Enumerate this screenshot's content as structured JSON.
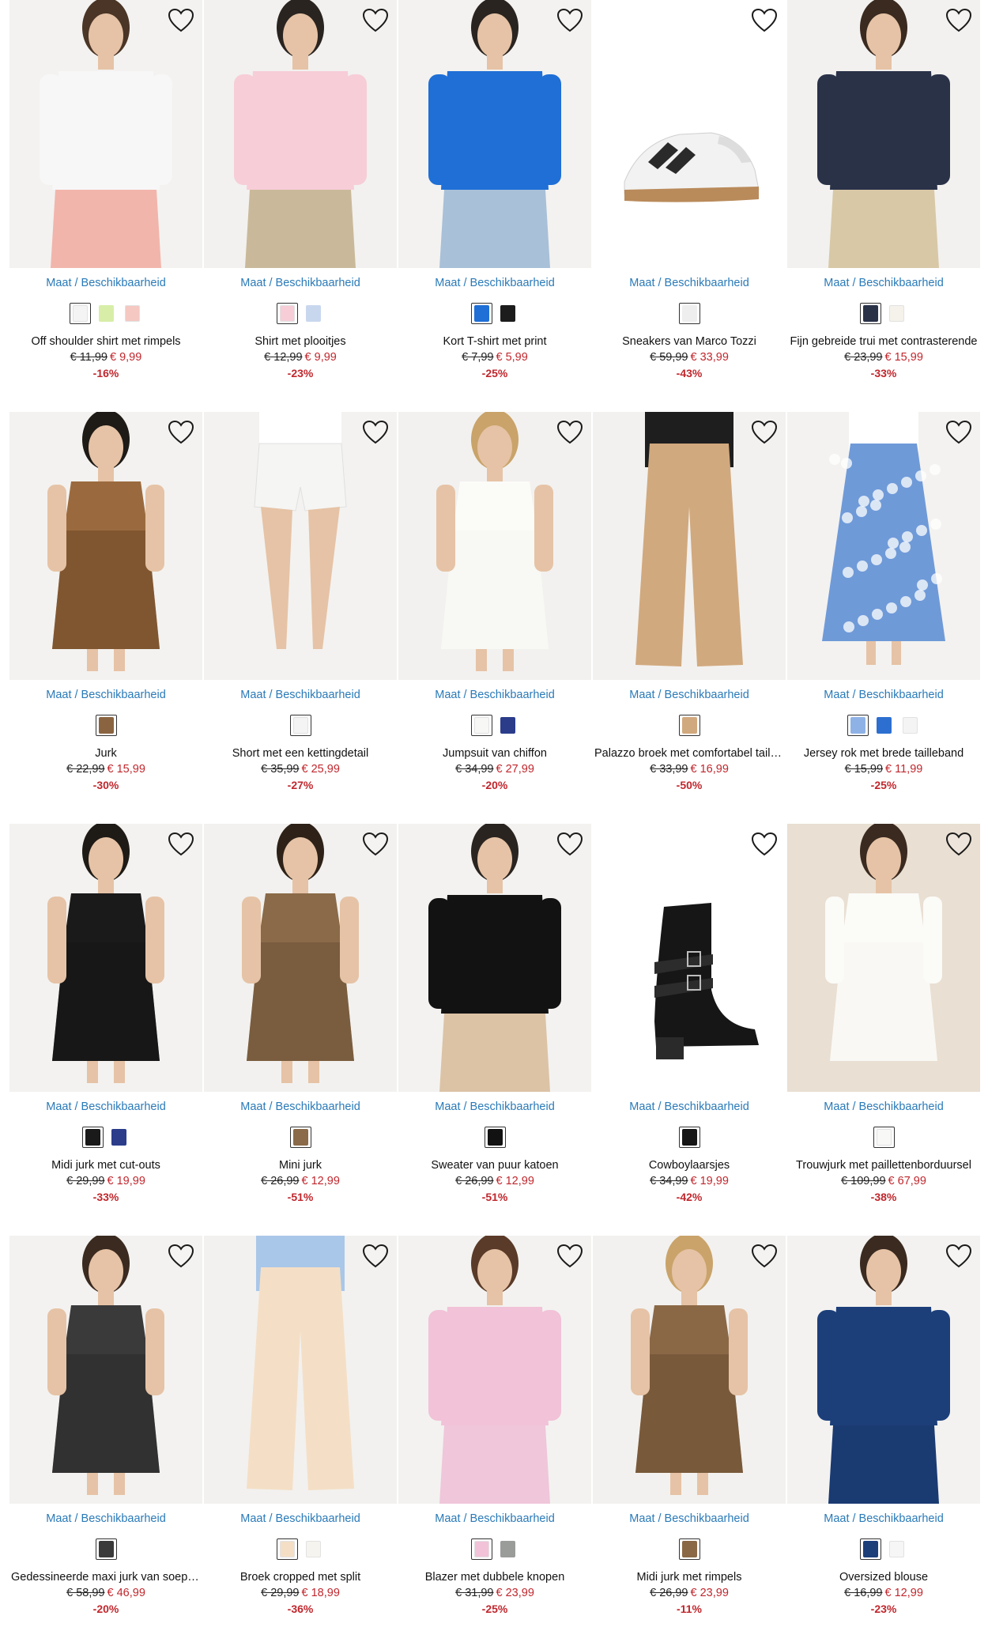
{
  "products": [
    {
      "name": "Off shoulder shirt met rimpels",
      "size_link": "Maat / Beschikbaarheid",
      "old_price": "€ 11,99",
      "new_price": "€ 9,99",
      "discount": "-16%",
      "image": {
        "kind": "model",
        "bg": "#f3f2f0",
        "top": "#f7f7f7",
        "bottom": "#f2b5ab",
        "hair": "#4a3526"
      },
      "swatches": [
        "#f4f4f4",
        "#d8eea8",
        "#f5c8c2"
      ]
    },
    {
      "name": "Shirt met plooitjes",
      "size_link": "Maat / Beschikbaarheid",
      "old_price": "€ 12,99",
      "new_price": "€ 9,99",
      "discount": "-23%",
      "image": {
        "kind": "model",
        "bg": "#f2f1ef",
        "top": "#f7cdd8",
        "bottom": "#c9b99a",
        "hair": "#2a2420"
      },
      "swatches": [
        "#f7cdd8",
        "#c9d7ee"
      ]
    },
    {
      "name": "Kort T-shirt met print",
      "size_link": "Maat / Beschikbaarheid",
      "old_price": "€ 7,99",
      "new_price": "€ 5,99",
      "discount": "-25%",
      "image": {
        "kind": "model",
        "bg": "#f3f2f0",
        "top": "#1f6fd6",
        "bottom": "#a8c0d8",
        "hair": "#2a2420"
      },
      "swatches": [
        "#1f6fd6",
        "#1c1c1c"
      ]
    },
    {
      "name": "Sneakers van Marco Tozzi",
      "size_link": "Maat / Beschikbaarheid",
      "old_price": "€ 59,99",
      "new_price": "€ 33,99",
      "discount": "-43%",
      "image": {
        "kind": "sneaker",
        "bg": "#ffffff",
        "top": "#f2f2f2",
        "bottom": "#2a2a2a",
        "hair": "#b98a5a"
      },
      "swatches": [
        "#eeeeee"
      ]
    },
    {
      "name": "Fijn gebreide trui met contrasterende",
      "size_link": "Maat / Beschikbaarheid",
      "old_price": "€ 23,99",
      "new_price": "€ 15,99",
      "discount": "-33%",
      "image": {
        "kind": "model",
        "bg": "#f2f1ef",
        "top": "#2a3248",
        "bottom": "#d8c8a6",
        "hair": "#3a2a20"
      },
      "swatches": [
        "#2a3248",
        "#f4f2ea"
      ]
    },
    {
      "name": "Jurk",
      "size_link": "Maat / Beschikbaarheid",
      "old_price": "€ 22,99",
      "new_price": "€ 15,99",
      "discount": "-30%",
      "image": {
        "kind": "dress",
        "bg": "#f3f2f0",
        "top": "#9a6a3e",
        "bottom": "#6b4526",
        "hair": "#1e1a16"
      },
      "swatches": [
        "#8a6440"
      ]
    },
    {
      "name": "Short met een kettingdetail",
      "size_link": "Maat / Beschikbaarheid",
      "old_price": "€ 35,99",
      "new_price": "€ 25,99",
      "discount": "-27%",
      "image": {
        "kind": "shorts",
        "bg": "#f3f2f0",
        "top": "#ffffff",
        "bottom": "#f5f5f3",
        "hair": "#e8c4a8"
      },
      "swatches": [
        "#f4f4f4"
      ]
    },
    {
      "name": "Jumpsuit van chiffon",
      "size_link": "Maat / Beschikbaarheid",
      "old_price": "€ 34,99",
      "new_price": "€ 27,99",
      "discount": "-20%",
      "image": {
        "kind": "dress",
        "bg": "#f2f1ef",
        "top": "#fbfbf8",
        "bottom": "#f6f5f0",
        "hair": "#c9a36a"
      },
      "swatches": [
        "#f7f7f5",
        "#2a3c8a"
      ]
    },
    {
      "name": "Palazzo broek met comfortabel tailleband",
      "size_link": "Maat / Beschikbaarheid",
      "old_price": "€ 33,99",
      "new_price": "€ 16,99",
      "discount": "-50%",
      "image": {
        "kind": "pants",
        "bg": "#f2f1ef",
        "top": "#1e1e1e",
        "bottom": "#d1a97e",
        "hair": "#e8c4a8"
      },
      "swatches": [
        "#d1a97e"
      ]
    },
    {
      "name": "Jersey rok met brede tailleband",
      "size_link": "Maat / Beschikbaarheid",
      "old_price": "€ 15,99",
      "new_price": "€ 11,99",
      "discount": "-25%",
      "image": {
        "kind": "skirt",
        "bg": "#f3f2f0",
        "top": "#ffffff",
        "bottom": "#6f9ad8",
        "hair": "#e8c4a8"
      },
      "swatches": [
        "#8fb2e6",
        "#2c6fd0",
        "#f4f4f4"
      ]
    },
    {
      "name": "Midi jurk met cut-outs",
      "size_link": "Maat / Beschikbaarheid",
      "old_price": "€ 29,99",
      "new_price": "€ 19,99",
      "discount": "-33%",
      "image": {
        "kind": "dress",
        "bg": "#f3f2f0",
        "top": "#1a1a1a",
        "bottom": "#151515",
        "hair": "#1e1a16"
      },
      "swatches": [
        "#1a1a1a",
        "#2a3c8a"
      ]
    },
    {
      "name": "Mini jurk",
      "size_link": "Maat / Beschikbaarheid",
      "old_price": "€ 26,99",
      "new_price": "€ 12,99",
      "discount": "-51%",
      "image": {
        "kind": "dress",
        "bg": "#f2f1ef",
        "top": "#8a6a48",
        "bottom": "#6e5238",
        "hair": "#2e2218"
      },
      "swatches": [
        "#8a6a48"
      ]
    },
    {
      "name": "Sweater van puur katoen",
      "size_link": "Maat / Beschikbaarheid",
      "old_price": "€ 26,99",
      "new_price": "€ 12,99",
      "discount": "-51%",
      "image": {
        "kind": "model",
        "bg": "#f3f2f0",
        "top": "#121212",
        "bottom": "#dcc3a6",
        "hair": "#2a2420"
      },
      "swatches": [
        "#121212"
      ]
    },
    {
      "name": "Cowboylaarsjes",
      "size_link": "Maat / Beschikbaarheid",
      "old_price": "€ 34,99",
      "new_price": "€ 19,99",
      "discount": "-42%",
      "image": {
        "kind": "boot",
        "bg": "#ffffff",
        "top": "#161616",
        "bottom": "#1e1e1e",
        "hair": "#c0c0c0"
      },
      "swatches": [
        "#161616"
      ]
    },
    {
      "name": "Trouwjurk met paillettenborduursel",
      "size_link": "Maat / Beschikbaarheid",
      "old_price": "€ 109,99",
      "new_price": "€ 67,99",
      "discount": "-38%",
      "image": {
        "kind": "gown",
        "bg": "#e9dfd2",
        "top": "#fbfbf8",
        "bottom": "#f7f6f1",
        "hair": "#3a2a20"
      },
      "swatches": [
        "#f8f8f6"
      ]
    },
    {
      "name": "Gedessineerde maxi jurk van soepele",
      "size_link": "Maat / Beschikbaarheid",
      "old_price": "€ 58,99",
      "new_price": "€ 46,99",
      "discount": "-20%",
      "image": {
        "kind": "dress",
        "bg": "#f3f2f0",
        "top": "#3a3a3a",
        "bottom": "#2a2a2a",
        "hair": "#3a2a20"
      },
      "swatches": [
        "#3a3a3a"
      ]
    },
    {
      "name": "Broek cropped met split",
      "size_link": "Maat / Beschikbaarheid",
      "old_price": "€ 29,99",
      "new_price": "€ 18,99",
      "discount": "-36%",
      "image": {
        "kind": "pants",
        "bg": "#f2f1ef",
        "top": "#a9c7e8",
        "bottom": "#f4dfc6",
        "hair": "#e8c4a8"
      },
      "swatches": [
        "#f4dfc6",
        "#f6f4ee"
      ]
    },
    {
      "name": "Blazer met dubbele knopen",
      "size_link": "Maat / Beschikbaarheid",
      "old_price": "€ 31,99",
      "new_price": "€ 23,99",
      "discount": "-25%",
      "image": {
        "kind": "model",
        "bg": "#f3f2f0",
        "top": "#f1c2d8",
        "bottom": "#efc6da",
        "hair": "#5a3a28"
      },
      "swatches": [
        "#f1c2d8",
        "#9a9c9a"
      ]
    },
    {
      "name": "Midi jurk met rimpels",
      "size_link": "Maat / Beschikbaarheid",
      "old_price": "€ 26,99",
      "new_price": "€ 23,99",
      "discount": "-11%",
      "image": {
        "kind": "dress",
        "bg": "#f2f1ef",
        "top": "#8a6846",
        "bottom": "#6a4c32",
        "hair": "#c9a36a"
      },
      "swatches": [
        "#8a6846"
      ]
    },
    {
      "name": "Oversized blouse",
      "size_link": "Maat / Beschikbaarheid",
      "old_price": "€ 16,99",
      "new_price": "€ 12,99",
      "discount": "-23%",
      "image": {
        "kind": "model",
        "bg": "#f3f2f0",
        "top": "#1c3f7a",
        "bottom": "#1a3a72",
        "hair": "#3a2a20"
      },
      "swatches": [
        "#1c3f7a",
        "#f6f6f6"
      ]
    }
  ]
}
